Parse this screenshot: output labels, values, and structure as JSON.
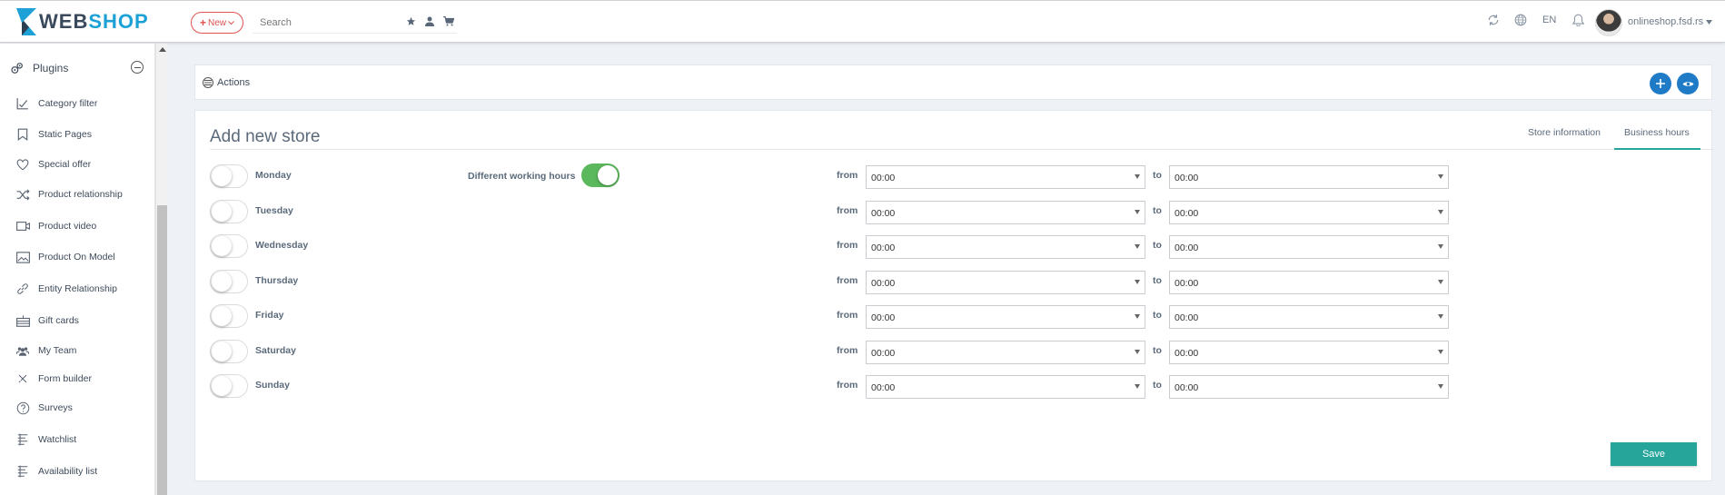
{
  "brand": {
    "web": "WEB",
    "shop": "SHOP",
    "accent": "#1da1d6"
  },
  "topbar": {
    "new_label": "New",
    "search_placeholder": "Search",
    "language": "EN",
    "user": "onlineshop.fsd.rs"
  },
  "sidebar": {
    "section": "Plugins",
    "items": [
      {
        "label": "Category filter",
        "icon": "checkbox-chart-icon"
      },
      {
        "label": "Static Pages",
        "icon": "bookmark-icon"
      },
      {
        "label": "Special offer",
        "icon": "heart-icon"
      },
      {
        "label": "Product relationship",
        "icon": "shuffle-icon"
      },
      {
        "label": "Product video",
        "icon": "video-icon"
      },
      {
        "label": "Product On Model",
        "icon": "image-icon"
      },
      {
        "label": "Entity Relationship",
        "icon": "link-icon"
      },
      {
        "label": "Gift cards",
        "icon": "gift-icon"
      },
      {
        "label": "My Team",
        "icon": "team-icon"
      },
      {
        "label": "Form builder",
        "icon": "tools-icon"
      },
      {
        "label": "Surveys",
        "icon": "question-icon"
      },
      {
        "label": "Watchlist",
        "icon": "list-icon"
      },
      {
        "label": "Availability list",
        "icon": "list-icon"
      }
    ]
  },
  "actions": {
    "label": "Actions"
  },
  "store": {
    "title": "Add new store",
    "tabs": [
      "Store information",
      "Business hours"
    ],
    "active_tab": "Business hours",
    "different_hours_label": "Different working hours",
    "different_hours_on": true,
    "from_label": "from",
    "to_label": "to",
    "days": [
      {
        "name": "Monday",
        "from": "00:00",
        "to": "00:00",
        "enabled": false
      },
      {
        "name": "Tuesday",
        "from": "00:00",
        "to": "00:00",
        "enabled": false
      },
      {
        "name": "Wednesday",
        "from": "00:00",
        "to": "00:00",
        "enabled": false
      },
      {
        "name": "Thursday",
        "from": "00:00",
        "to": "00:00",
        "enabled": false
      },
      {
        "name": "Friday",
        "from": "00:00",
        "to": "00:00",
        "enabled": false
      },
      {
        "name": "Saturday",
        "from": "00:00",
        "to": "00:00",
        "enabled": false
      },
      {
        "name": "Sunday",
        "from": "00:00",
        "to": "00:00",
        "enabled": false
      }
    ],
    "save_label": "Save",
    "accent": "#26a69a"
  }
}
